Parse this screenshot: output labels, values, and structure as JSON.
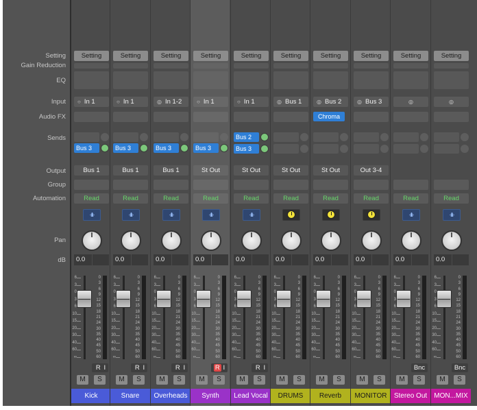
{
  "row_labels": {
    "setting": "Setting",
    "gain_reduction": "Gain Reduction",
    "eq": "EQ",
    "input": "Input",
    "audio_fx": "Audio FX",
    "sends": "Sends",
    "output": "Output",
    "group": "Group",
    "automation": "Automation",
    "pan": "Pan",
    "db": "dB"
  },
  "fader_scale": [
    "6",
    "3",
    "0",
    "3",
    "6",
    "10",
    "15",
    "20",
    "30",
    "40",
    "60",
    "∞"
  ],
  "meter_scale": [
    "0",
    "3",
    "6",
    "9",
    "12",
    "15",
    "18",
    "21",
    "24",
    "30",
    "35",
    "40",
    "45",
    "50",
    "60"
  ],
  "colors": {
    "mixer_bg": "#4c4c4c",
    "send_blue": "#2f7fd6",
    "automation_green": "#67d66a",
    "record_red": "#e04848"
  },
  "strips": [
    {
      "name": "Kick",
      "color": "#4a5bd8",
      "setting": "Setting",
      "input_icon": "mono-circle-icon",
      "input_glyph": "○",
      "input": "In 1",
      "fx": "",
      "sends": [
        {
          "label": "Bus 3"
        }
      ],
      "output": "Bus 1",
      "automation": "Read",
      "plugin_type": "waveform",
      "plugin_glyph": "·ıllı·",
      "db": "0.0",
      "fader_level": 0.78,
      "footer": "ri",
      "rec_label": "R",
      "input_mon_label": "I",
      "rec_on": false,
      "mute": "M",
      "solo": "S",
      "selected": false
    },
    {
      "name": "Snare",
      "color": "#4a5bd8",
      "setting": "Setting",
      "input_icon": "mono-circle-icon",
      "input_glyph": "○",
      "input": "In 1",
      "fx": "",
      "sends": [
        {
          "label": "Bus 3"
        }
      ],
      "output": "Bus 1",
      "automation": "Read",
      "plugin_type": "waveform",
      "plugin_glyph": "·ıllı·",
      "db": "0.0",
      "fader_level": 0.78,
      "footer": "ri",
      "rec_label": "R",
      "input_mon_label": "I",
      "rec_on": false,
      "mute": "M",
      "solo": "S",
      "selected": false
    },
    {
      "name": "Overheads",
      "color": "#4a5bd8",
      "setting": "Setting",
      "input_icon": "stereo-circles-icon",
      "input_glyph": "◎",
      "input": "In 1-2",
      "fx": "",
      "sends": [
        {
          "label": "Bus 3"
        }
      ],
      "output": "Bus 1",
      "automation": "Read",
      "plugin_type": "waveform",
      "plugin_glyph": "·ıllı·",
      "db": "0.0",
      "fader_level": 0.78,
      "footer": "ri",
      "rec_label": "R",
      "input_mon_label": "I",
      "rec_on": false,
      "mute": "M",
      "solo": "S",
      "selected": false
    },
    {
      "name": "Synth",
      "color": "#9a32c8",
      "setting": "Setting",
      "input_icon": "mono-circle-icon",
      "input_glyph": "○",
      "input": "In 1",
      "fx": "",
      "sends": [
        {
          "label": "Bus 3"
        }
      ],
      "output": "St Out",
      "automation": "Read",
      "plugin_type": "waveform",
      "plugin_glyph": "·ıllı·",
      "db": "0.0",
      "fader_level": 0.78,
      "footer": "ri",
      "rec_label": "R",
      "input_mon_label": "I",
      "rec_on": true,
      "mute": "M",
      "solo": "S",
      "selected": true
    },
    {
      "name": "Lead Vocal",
      "color": "#9a32c8",
      "setting": "Setting",
      "input_icon": "mono-circle-icon",
      "input_glyph": "○",
      "input": "In 1",
      "fx": "",
      "sends": [
        {
          "label": "Bus 2"
        },
        {
          "label": "Bus 3"
        }
      ],
      "output": "St Out",
      "automation": "Read",
      "plugin_type": "waveform",
      "plugin_glyph": "·ıllı·",
      "db": "0.0",
      "fader_level": 0.78,
      "footer": "ri",
      "rec_label": "R",
      "input_mon_label": "I",
      "rec_on": false,
      "mute": "M",
      "solo": "S",
      "selected": false
    },
    {
      "name": "DRUMS",
      "color": "#b1b21e",
      "setting": "Setting",
      "input_icon": "stereo-circles-icon",
      "input_glyph": "◎",
      "input": "Bus 1",
      "fx": "",
      "sends": [],
      "output": "St Out",
      "automation": "Read",
      "plugin_type": "dial",
      "plugin_glyph": "",
      "db": "0.0",
      "fader_level": 0.78,
      "footer": "none",
      "mute": "M",
      "solo": "S",
      "selected": false
    },
    {
      "name": "Reverb",
      "color": "#b1b21e",
      "setting": "Setting",
      "input_icon": "stereo-circles-icon",
      "input_glyph": "◎",
      "input": "Bus 2",
      "fx": "Chroma",
      "sends": [],
      "output": "St Out",
      "automation": "Read",
      "plugin_type": "dial",
      "plugin_glyph": "",
      "db": "0.0",
      "fader_level": 0.78,
      "footer": "none",
      "mute": "M",
      "solo": "S",
      "selected": false
    },
    {
      "name": "MONITOR",
      "color": "#b1b21e",
      "setting": "Setting",
      "input_icon": "stereo-circles-icon",
      "input_glyph": "◎",
      "input": "Bus 3",
      "fx": "",
      "sends": [],
      "output": "Out 3-4",
      "automation": "Read",
      "plugin_type": "dial",
      "plugin_glyph": "",
      "db": "0.0",
      "fader_level": 0.78,
      "footer": "none",
      "mute": "M",
      "solo": "S",
      "selected": false
    },
    {
      "name": "Stereo Out",
      "color": "#c3189f",
      "setting": "Setting",
      "input_icon": "stereo-circles-icon",
      "input_glyph": "◎",
      "input": "",
      "fx": "",
      "sends": [],
      "output": "",
      "automation": "Read",
      "plugin_type": "waveform",
      "plugin_glyph": "·ıllı·",
      "db": "0.0",
      "fader_level": 0.78,
      "footer": "bnc",
      "bnc_label": "Bnc",
      "mute": "M",
      "solo": "S",
      "selected": false
    },
    {
      "name": "MON...MIX",
      "color": "#c3189f",
      "setting": "Setting",
      "input_icon": "stereo-circles-icon",
      "input_glyph": "◎",
      "input": "",
      "fx": "",
      "sends": [],
      "output": "",
      "automation": "Read",
      "plugin_type": "waveform",
      "plugin_glyph": "·ıllı·",
      "db": "0.0",
      "fader_level": 0.78,
      "footer": "bnc",
      "bnc_label": "Bnc",
      "mute": "M",
      "solo": "S",
      "selected": false
    }
  ]
}
